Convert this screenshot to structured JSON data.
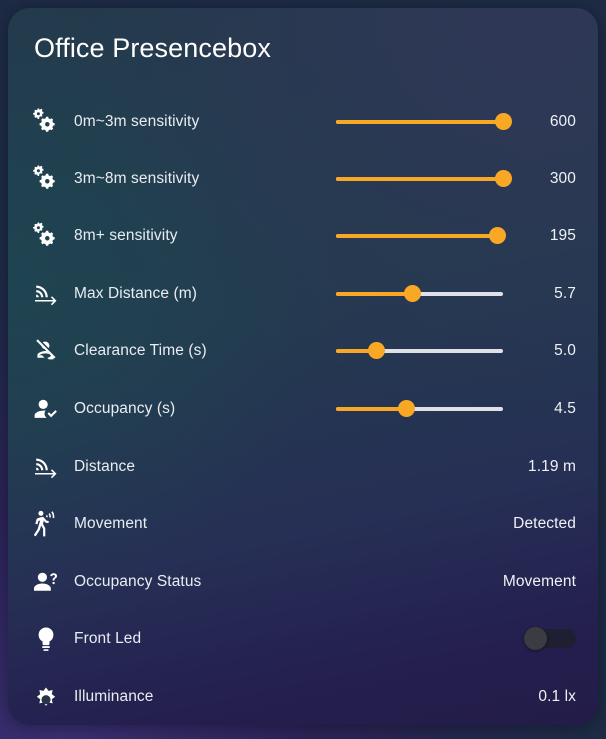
{
  "card": {
    "title": "Office Presencebox",
    "accent_color": "#f9a825",
    "track_color": "#e0e0e8",
    "text_color": "#e9edf2"
  },
  "rows": [
    {
      "icon": "cogs-icon",
      "label": "0m~3m sensitivity",
      "kind": "slider",
      "value": "600",
      "percent": 100
    },
    {
      "icon": "cogs-icon",
      "label": "3m~8m sensitivity",
      "kind": "slider",
      "value": "300",
      "percent": 100
    },
    {
      "icon": "cogs-icon",
      "label": "8m+ sensitivity",
      "kind": "slider",
      "value": "195",
      "percent": 97
    },
    {
      "icon": "signal-distance-icon",
      "label": "Max Distance (m)",
      "kind": "slider",
      "value": "5.7",
      "percent": 46
    },
    {
      "icon": "account-off-icon",
      "label": "Clearance Time (s)",
      "kind": "slider",
      "value": "5.0",
      "percent": 24
    },
    {
      "icon": "account-check-icon",
      "label": "Occupancy (s)",
      "kind": "slider",
      "value": "4.5",
      "percent": 42
    },
    {
      "icon": "signal-distance-icon",
      "label": "Distance",
      "kind": "value",
      "value": "1.19 m"
    },
    {
      "icon": "walk-motion-icon",
      "label": "Movement",
      "kind": "value",
      "value": "Detected"
    },
    {
      "icon": "account-question-icon",
      "label": "Occupancy Status",
      "kind": "value",
      "value": "Movement"
    },
    {
      "icon": "lightbulb-icon",
      "label": "Front Led",
      "kind": "toggle",
      "value": "off"
    },
    {
      "icon": "brightness-icon",
      "label": "Illuminance",
      "kind": "value",
      "value": "0.1 lx"
    }
  ]
}
